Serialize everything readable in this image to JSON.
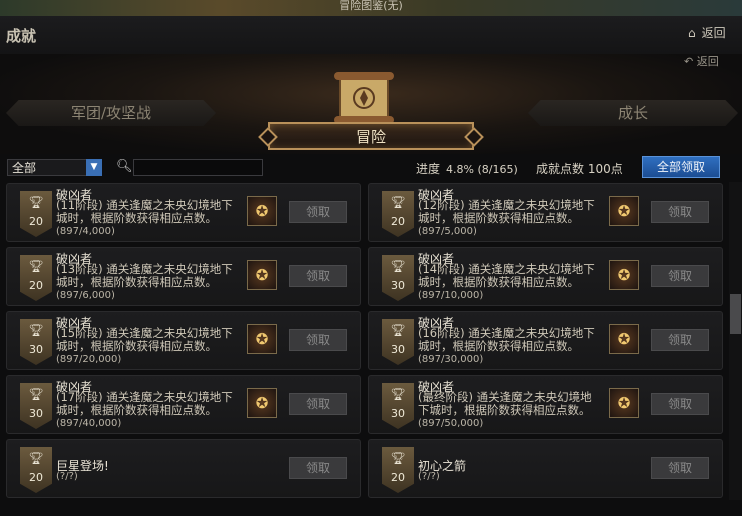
{
  "window": {
    "top_title": "冒险图鉴(无)",
    "title": "成就",
    "back_label": "返回",
    "sub_back_label": "返回"
  },
  "tabs": {
    "left": "军团/攻坚战",
    "center": "冒险",
    "right": "成长"
  },
  "filter": {
    "select_value": "全部",
    "search_placeholder": ""
  },
  "stats": {
    "progress_label": "进度",
    "progress_value": "4.8% (8/165)",
    "points_label": "成就点数 100点"
  },
  "claim_all_label": "全部领取",
  "achievements": [
    {
      "points": "20",
      "name": "破凶者",
      "desc": "(11阶段) 通关逢魔之未央幻境地下城时，根据阶数获得相应点数。",
      "progress": "(897/4,000)",
      "claim": "领取"
    },
    {
      "points": "20",
      "name": "破凶者",
      "desc": "(12阶段) 通关逢魔之未央幻境地下城时，根据阶数获得相应点数。",
      "progress": "(897/5,000)",
      "claim": "领取"
    },
    {
      "points": "20",
      "name": "破凶者",
      "desc": "(13阶段) 通关逢魔之未央幻境地下城时，根据阶数获得相应点数。",
      "progress": "(897/6,000)",
      "claim": "领取"
    },
    {
      "points": "30",
      "name": "破凶者",
      "desc": "(14阶段) 通关逢魔之未央幻境地下城时，根据阶数获得相应点数。",
      "progress": "(897/10,000)",
      "claim": "领取"
    },
    {
      "points": "30",
      "name": "破凶者",
      "desc": "(15阶段) 通关逢魔之未央幻境地下城时，根据阶数获得相应点数。",
      "progress": "(897/20,000)",
      "claim": "领取"
    },
    {
      "points": "30",
      "name": "破凶者",
      "desc": "(16阶段) 通关逢魔之未央幻境地下城时，根据阶数获得相应点数。",
      "progress": "(897/30,000)",
      "claim": "领取"
    },
    {
      "points": "30",
      "name": "破凶者",
      "desc": "(17阶段) 通关逢魔之未央幻境地下城时，根据阶数获得相应点数。",
      "progress": "(897/40,000)",
      "claim": "领取"
    },
    {
      "points": "30",
      "name": "破凶者",
      "desc": "(最终阶段) 通关逢魔之未央幻境地下城时，根据阶数获得相应点数。",
      "progress": "(897/50,000)",
      "claim": "领取"
    },
    {
      "points": "20",
      "name": "巨星登场!",
      "desc": "",
      "progress": "(?/?)",
      "claim": "领取"
    },
    {
      "points": "20",
      "name": "初心之箭",
      "desc": "",
      "progress": "(?/?)",
      "claim": "领取"
    }
  ]
}
